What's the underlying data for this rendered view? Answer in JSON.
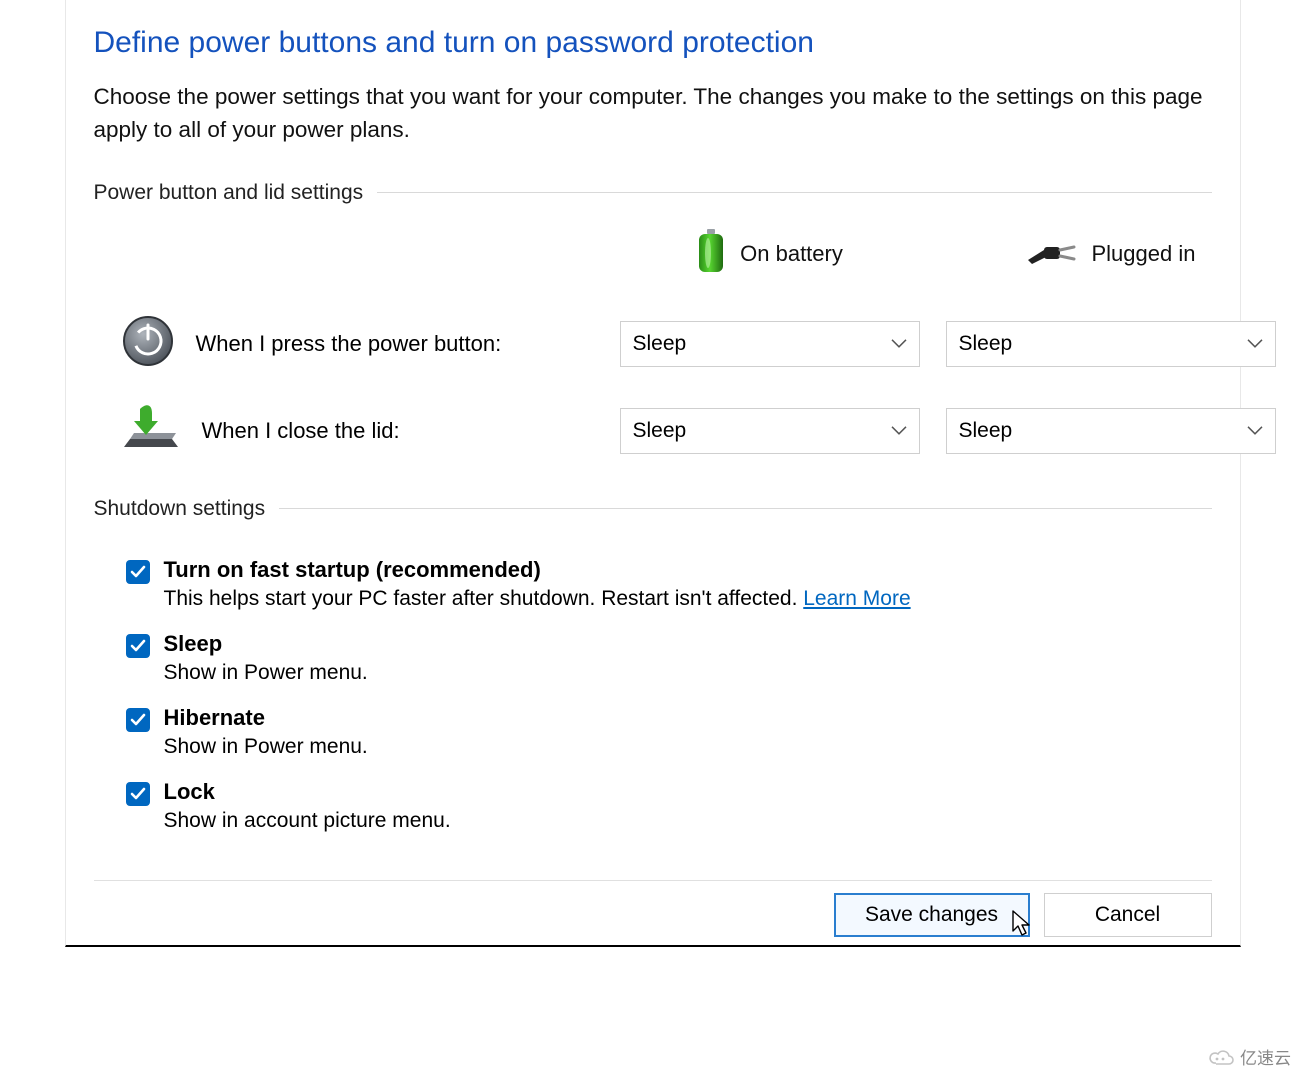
{
  "title": "Define power buttons and turn on password protection",
  "subtitle": "Choose the power settings that you want for your computer. The changes you make to the settings on this page apply to all of your power plans.",
  "group1": {
    "heading": "Power button and lid settings",
    "column_battery": "On battery",
    "column_plugged": "Plugged in",
    "rows": [
      {
        "label": "When I press the power button:",
        "battery_value": "Sleep",
        "plugged_value": "Sleep"
      },
      {
        "label": "When I close the lid:",
        "battery_value": "Sleep",
        "plugged_value": "Sleep"
      }
    ]
  },
  "group2": {
    "heading": "Shutdown settings",
    "items": [
      {
        "title": "Turn on fast startup (recommended)",
        "desc": "This helps start your PC faster after shutdown. Restart isn't affected. ",
        "link": "Learn More",
        "checked": true
      },
      {
        "title": "Sleep",
        "desc": "Show in Power menu.",
        "checked": true
      },
      {
        "title": "Hibernate",
        "desc": "Show in Power menu.",
        "checked": true
      },
      {
        "title": "Lock",
        "desc": "Show in account picture menu.",
        "checked": true
      }
    ]
  },
  "footer": {
    "save": "Save changes",
    "cancel": "Cancel"
  },
  "watermark": "亿速云",
  "colors": {
    "heading": "#1452bd",
    "accent": "#0067c0",
    "button_focus": "#2a7ecf"
  }
}
